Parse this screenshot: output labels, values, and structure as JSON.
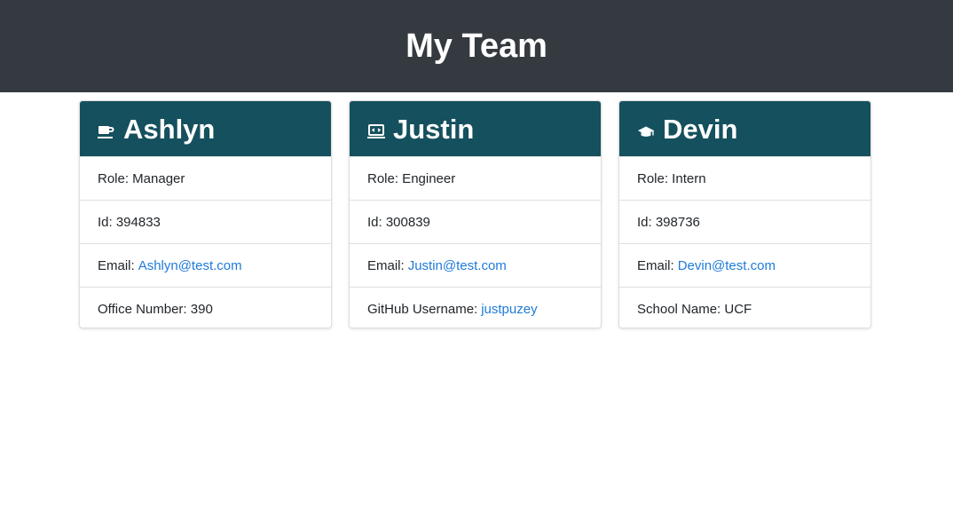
{
  "header": {
    "title": "My Team"
  },
  "colors": {
    "header_bg": "#343a40",
    "card_head_bg": "#15505e",
    "link": "#1f7ad9"
  },
  "cards": [
    {
      "icon": "coffee-mug-icon",
      "name": "Ashlyn",
      "role": "Role: Manager",
      "id": "Id: 394833",
      "email_label": "Email:",
      "email": "Ashlyn@test.com",
      "extra_label": "Office Number: 390"
    },
    {
      "icon": "laptop-code-icon",
      "name": "Justin",
      "role": "Role: Engineer",
      "id": "Id: 300839",
      "email_label": "Email:",
      "email": "Justin@test.com",
      "extra_label": "GitHub Username:",
      "extra_link": "justpuzey"
    },
    {
      "icon": "graduation-cap-icon",
      "name": "Devin",
      "role": "Role: Intern",
      "id": "Id: 398736",
      "email_label": "Email:",
      "email": "Devin@test.com",
      "extra_label": "School Name: UCF"
    }
  ]
}
